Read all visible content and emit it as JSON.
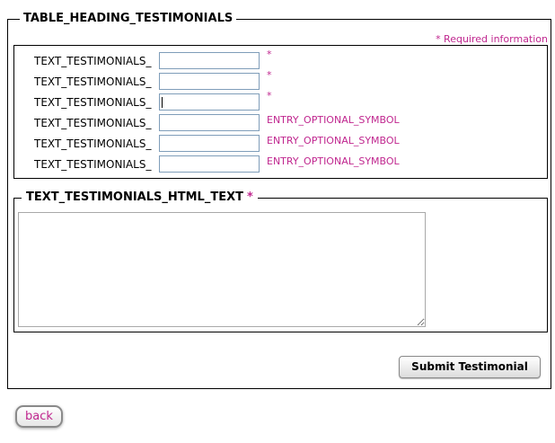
{
  "form": {
    "heading": "TABLE_HEADING_TESTIMONIALS",
    "required_note": "* Required information",
    "fields": [
      {
        "label": "TEXT_TESTIMONIALS_",
        "value": "",
        "symbol": "*"
      },
      {
        "label": "TEXT_TESTIMONIALS_",
        "value": "",
        "symbol": "*"
      },
      {
        "label": "TEXT_TESTIMONIALS_",
        "value": "",
        "symbol": "*"
      },
      {
        "label": "TEXT_TESTIMONIALS_",
        "value": "",
        "symbol": "ENTRY_OPTIONAL_SYMBOL"
      },
      {
        "label": "TEXT_TESTIMONIALS_",
        "value": "",
        "symbol": "ENTRY_OPTIONAL_SYMBOL"
      },
      {
        "label": "TEXT_TESTIMONIALS_",
        "value": "",
        "symbol": "ENTRY_OPTIONAL_SYMBOL"
      }
    ],
    "html_text_heading": "TEXT_TESTIMONIALS_HTML_TEXT",
    "html_text_required": "*",
    "html_text_value": "",
    "submit_label": "Submit Testimonial"
  },
  "back_label": "back",
  "colors": {
    "required": "#c0278f",
    "input_border": "#7f9db9"
  }
}
